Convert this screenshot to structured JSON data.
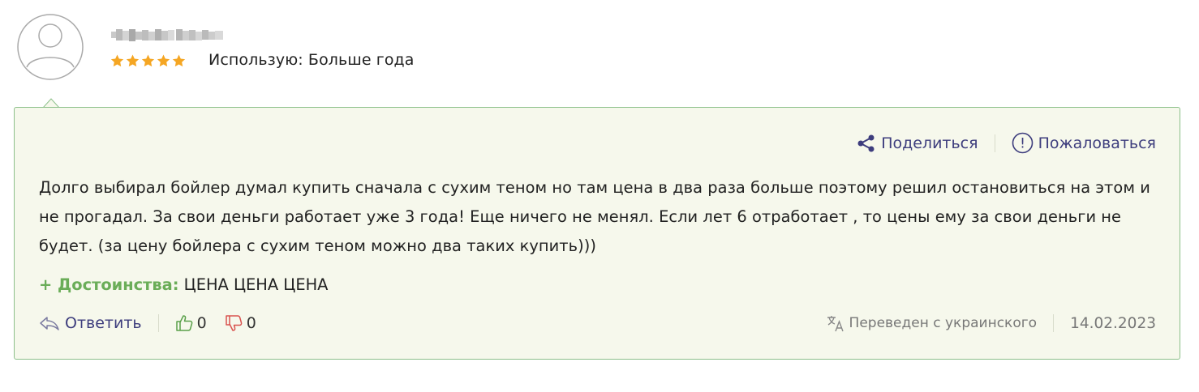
{
  "user": {
    "name_blurred": "",
    "rating": 5,
    "usage_text": "Использую: Больше года"
  },
  "actions": {
    "share_label": "Поделиться",
    "report_label": "Пожаловаться"
  },
  "review": {
    "text": "Долго выбирал бойлер думал купить сначала с сухим теном но там цена в два раза больше поэтому решил остановиться на этом и не прогадал. За свои деньги работает уже 3 года! Еще ничего не менял. Если лет 6 отработает , то цены ему за свои деньги не будет. (за цену бойлера с сухим теном можно два таких купить)))",
    "pros_label": "+ Достоинства:",
    "pros_value": "ЦЕНА ЦЕНА ЦЕНА"
  },
  "footer": {
    "reply_label": "Ответить",
    "likes": "0",
    "dislikes": "0",
    "translated_label": "Переведен с украинского",
    "date": "14.02.2023"
  },
  "colors": {
    "accent_link": "#3d3d7d",
    "pros_green": "#6aad58",
    "card_bg": "#f6f8ec",
    "card_border": "#8cc08a",
    "star": "#f5a623",
    "dislike_red": "#d9534f"
  },
  "icons": {
    "star": "star-icon",
    "share": "share-icon",
    "report": "exclamation-circle-icon",
    "reply": "reply-arrow-icon",
    "like": "thumbs-up-icon",
    "dislike": "thumbs-down-icon",
    "translate": "translate-icon"
  }
}
